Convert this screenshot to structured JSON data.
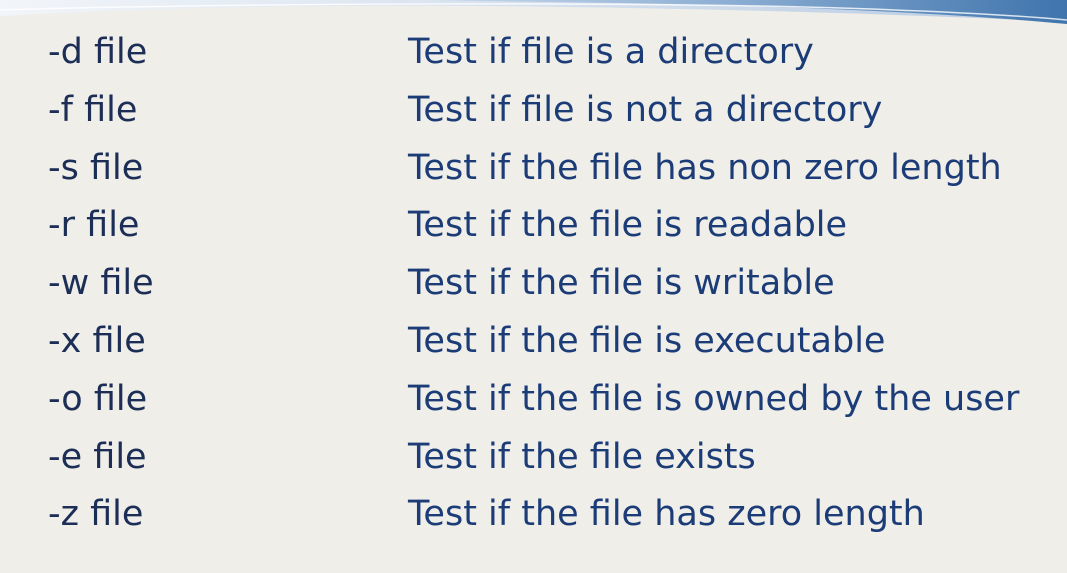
{
  "slide": {
    "background_color": "#EFEEE9",
    "accent_color": "#4F82B8",
    "rows": [
      {
        "flag": "-d file",
        "description": "Test if file is a directory"
      },
      {
        "flag": "-f file",
        "description": "Test if file is not a directory"
      },
      {
        "flag": "-s file",
        "description": "Test if the file has non zero length"
      },
      {
        "flag": "-r file",
        "description": "Test if the file is readable"
      },
      {
        "flag": "-w file",
        "description": "Test if the file is writable"
      },
      {
        "flag": "-x file",
        "description": "Test if the file is executable"
      },
      {
        "flag": "-o file",
        "description": "Test if the file is owned by the user"
      },
      {
        "flag": "-e file",
        "description": "Test if the file exists"
      },
      {
        "flag": "-z file",
        "description": "Test if the file has zero length"
      }
    ]
  }
}
